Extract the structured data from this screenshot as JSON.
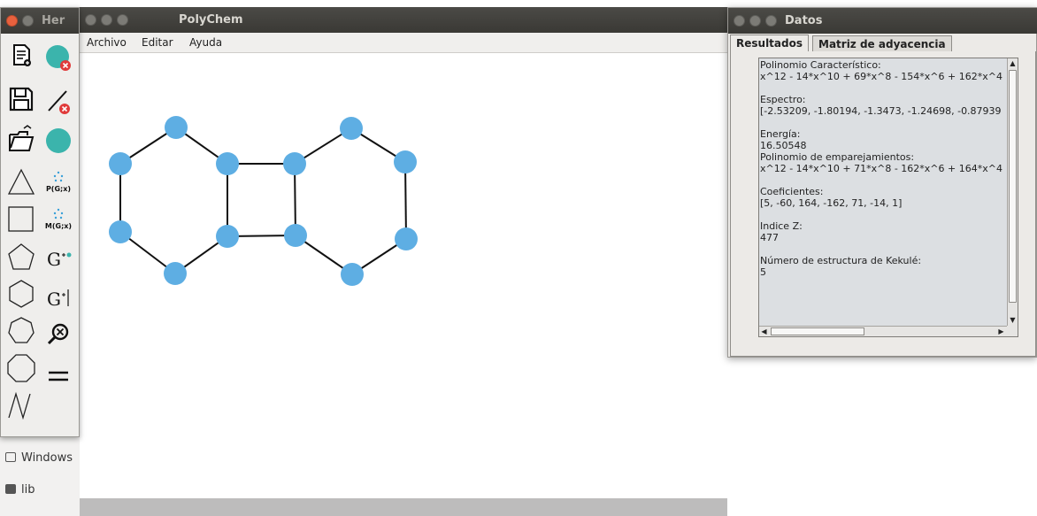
{
  "main_window": {
    "title": "PolyChem",
    "menu": [
      "Archivo",
      "Editar",
      "Ayuda"
    ]
  },
  "tools_window": {
    "title": "Her",
    "tool_labels": {
      "p_polynomial": "P(G;x)",
      "m_polynomial": "M(G;x)",
      "g_add_vertex": "G",
      "g_add_edge": "G",
      "equals": "="
    }
  },
  "background_files": {
    "items": [
      "Windows",
      "lib"
    ]
  },
  "datos_window": {
    "title": "Datos",
    "tabs": [
      "Resultados",
      "Matriz de adyacencia"
    ],
    "active_tab": "Resultados",
    "results_text": "Polinomio Característico:\nx^12 - 14*x^10 + 69*x^8 - 154*x^6 + 162*x^4\n\nEspectro:\n[-2.53209, -1.80194, -1.3473, -1.24698, -0.87939\n\nEnergía:\n16.50548\nPolinomio de emparejamientos:\nx^12 - 14*x^10 + 71*x^8 - 162*x^6 + 164*x^4\n\nCoeficientes:\n[5, -60, 164, -162, 71, -14, 1]\n\nIndice Z:\n477\n\nNúmero de estructura de Kekulé:\n5"
  },
  "colors": {
    "vertex": "#5eaee3",
    "edge": "#111111",
    "titlebar": "#3f3e3a",
    "close_button": "#e8613e"
  }
}
